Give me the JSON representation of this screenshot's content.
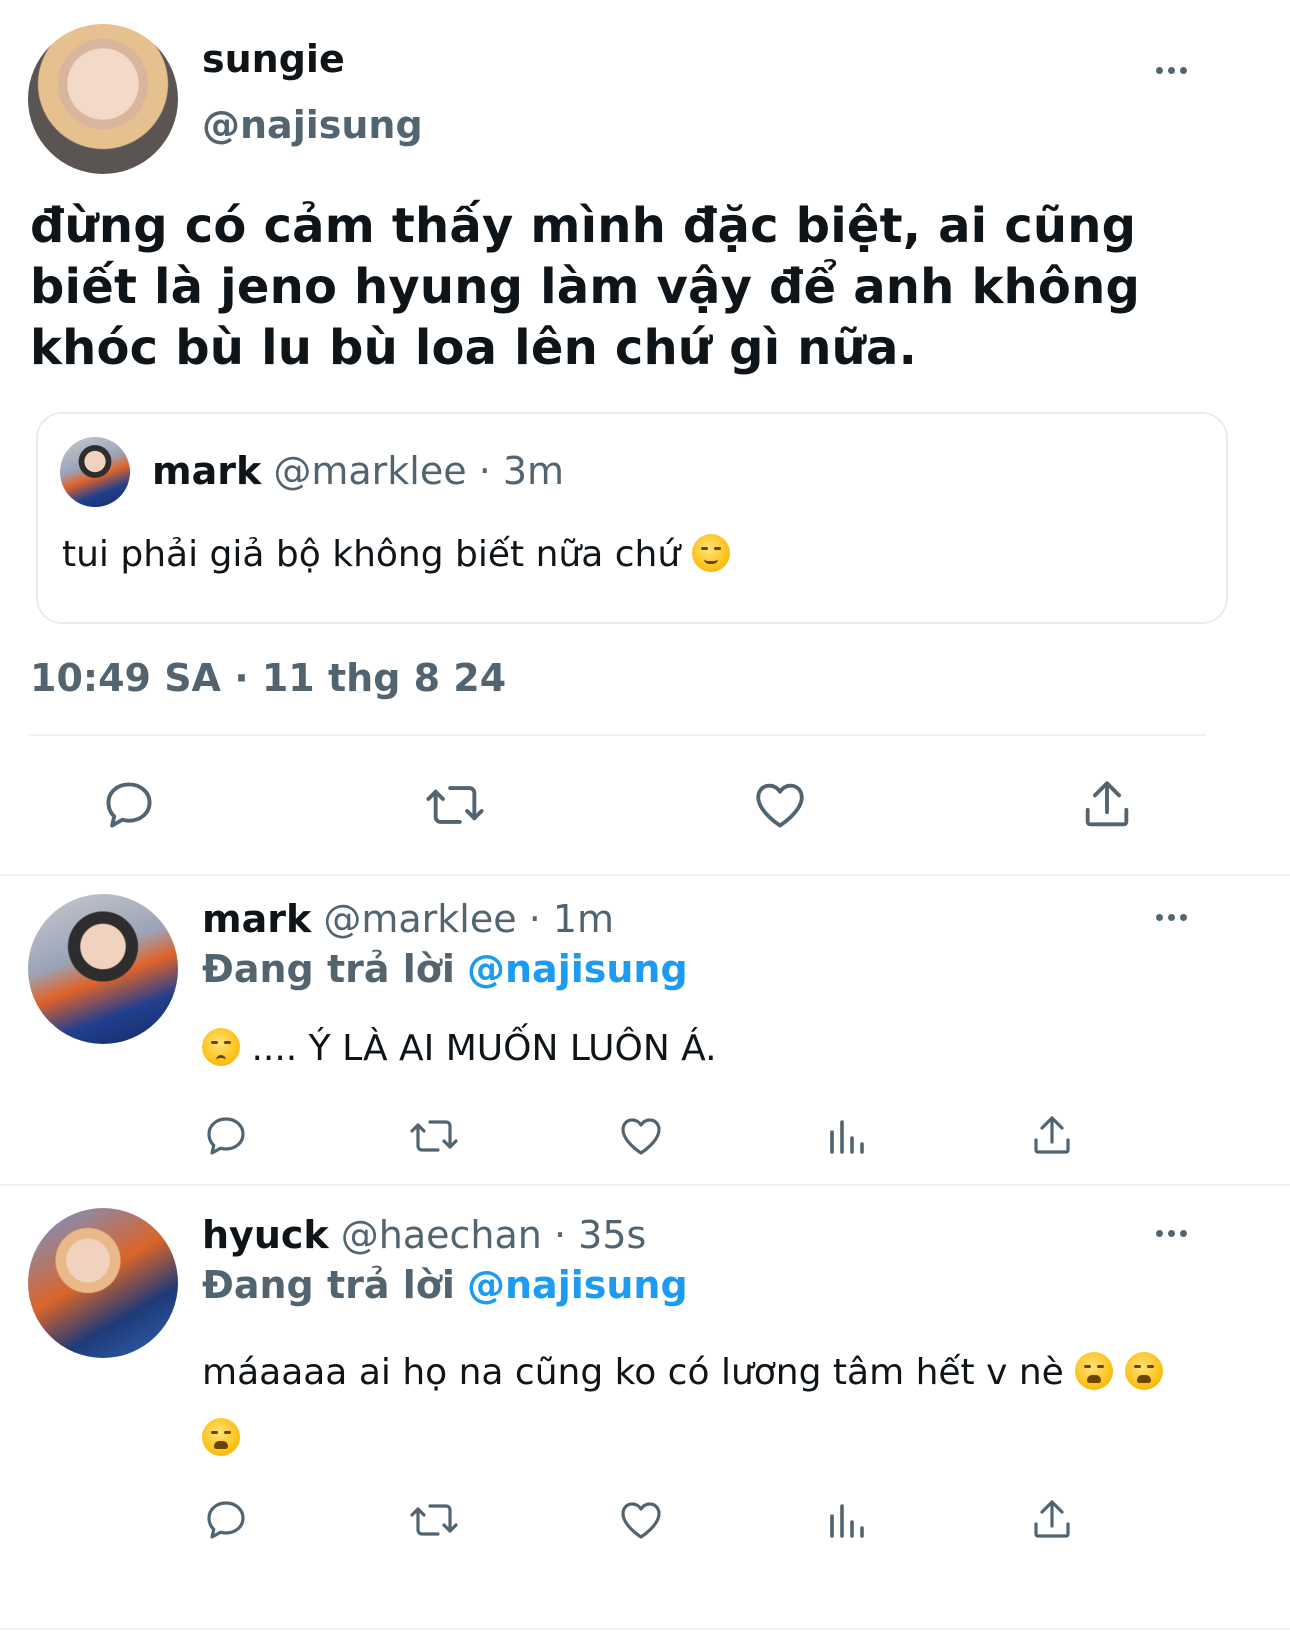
{
  "main_tweet": {
    "display_name": "sungie",
    "handle": "@najisung",
    "text": "đừng có cảm thấy mình đặc biệt, ai cũng biết là jeno hyung làm vậy để anh không khóc bù lu bù loa lên chứ gì nữa.",
    "timestamp": "10:49 SA · 11 thg 8 24",
    "quoted": {
      "display_name": "mark",
      "handle": "@marklee",
      "time": "· 3m",
      "text": "tui phải giả bộ không biết nữa chứ",
      "emoji": "relieved-face"
    },
    "actions": [
      "reply-icon",
      "retweet-icon",
      "like-icon",
      "share-icon"
    ]
  },
  "replies": [
    {
      "display_name": "mark",
      "handle": "@marklee",
      "time": "· 1m",
      "replying_label": "Đang trả lời",
      "replying_to": "@najisung",
      "text": ".... Ý LÀ AI MUỐN LUÔN Á.",
      "emoji": "worried-face",
      "actions": [
        "reply-icon",
        "retweet-icon",
        "like-icon",
        "views-icon",
        "share-icon"
      ]
    },
    {
      "display_name": "hyuck",
      "handle": "@haechan",
      "time": "· 35s",
      "replying_label": "Đang trả lời",
      "replying_to": "@najisung",
      "text": "máaaaa ai họ na cũng ko có lương tâm hết v nè",
      "emoji": "weary-face",
      "actions": [
        "reply-icon",
        "retweet-icon",
        "like-icon",
        "views-icon",
        "share-icon"
      ]
    }
  ],
  "colors": {
    "text": "#0f1419",
    "muted": "#536471",
    "link": "#1d9bf0",
    "border": "#eff3f4"
  }
}
